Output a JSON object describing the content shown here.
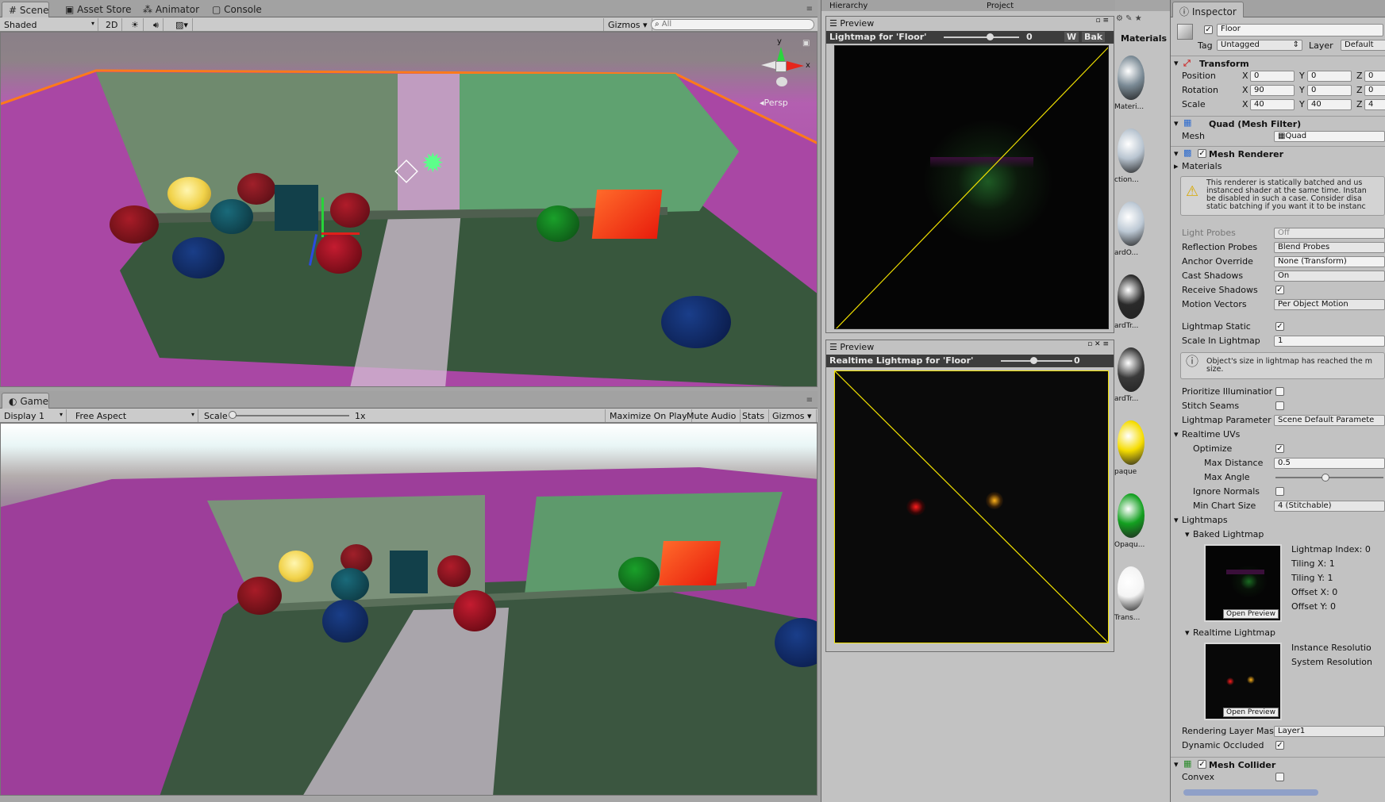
{
  "scene": {
    "tabs": [
      {
        "label": "Scene"
      },
      {
        "label": "Asset Store"
      },
      {
        "label": "Animator"
      },
      {
        "label": "Console"
      }
    ],
    "shading_mode": "Shaded",
    "mode_2d": "2D",
    "gizmos": "Gizmos",
    "search_placeholder": "All",
    "persp_label": "Persp",
    "axis_y": "y",
    "axis_x": "x"
  },
  "game": {
    "tab": "Game",
    "display": "Display 1",
    "aspect": "Free Aspect",
    "scale_label": "Scale",
    "scale_value": "1x",
    "buttons": [
      "Maximize On Play",
      "Mute Audio",
      "Stats",
      "Gizmos"
    ]
  },
  "middle": {
    "hierarchy_tab": "Hierarchy",
    "project_tab": "Project",
    "materials_header": "Materials",
    "preview1": {
      "tab": "Preview",
      "title": "Lightmap for 'Floor'",
      "value": "0",
      "w_btn": "W",
      "bake_btn": "Bak"
    },
    "preview2": {
      "tab": "Preview",
      "title": "Realtime Lightmap for 'Floor'",
      "value": "0"
    },
    "materials": [
      {
        "label": "Materi...",
        "color": "#7a8a95"
      },
      {
        "label": "ction...",
        "color": "#b8c4d0"
      },
      {
        "label": "ardO...",
        "color": "#bcc8d4"
      },
      {
        "label": "ardTr...",
        "color": "#2a2a2a"
      },
      {
        "label": "ardTr...",
        "color": "#3a3a3a"
      },
      {
        "label": "paque",
        "color": "#f5dc00"
      },
      {
        "label": "Opaqu...",
        "color": "#13a020"
      },
      {
        "label": "Trans...",
        "color": "#f4f4f4"
      }
    ]
  },
  "inspector": {
    "tab": "Inspector",
    "object_name": "Floor",
    "tag_label": "Tag",
    "tag_value": "Untagged",
    "layer_label": "Layer",
    "layer_value": "Default",
    "transform": {
      "title": "Transform",
      "rows": [
        {
          "label": "Position",
          "x": "0",
          "y": "0",
          "z": "0"
        },
        {
          "label": "Rotation",
          "x": "90",
          "y": "0",
          "z": "0"
        },
        {
          "label": "Scale",
          "x": "40",
          "y": "40",
          "z": "4"
        }
      ]
    },
    "mesh_filter": {
      "title": "Quad (Mesh Filter)",
      "mesh_label": "Mesh",
      "mesh_value": "Quad"
    },
    "mesh_renderer": {
      "title": "Mesh Renderer",
      "materials_label": "Materials",
      "warning_lines": [
        "This renderer is statically batched and us",
        "instanced shader at the same time. Instan",
        "be disabled in such a case. Consider disa",
        "static batching if you want it to be instanc"
      ],
      "light_probes_label": "Light Probes",
      "light_probes_value": "Off",
      "reflection_probes_label": "Reflection Probes",
      "reflection_probes_value": "Blend Probes",
      "anchor_override_label": "Anchor Override",
      "anchor_override_value": "None (Transform)",
      "cast_shadows_label": "Cast Shadows",
      "cast_shadows_value": "On",
      "receive_shadows_label": "Receive Shadows",
      "motion_vectors_label": "Motion Vectors",
      "motion_vectors_value": "Per Object Motion",
      "lightmap_static_label": "Lightmap Static",
      "scale_in_lightmap_label": "Scale In Lightmap",
      "scale_in_lightmap_value": "1",
      "info_lines": [
        "Object's size in lightmap has reached the m",
        "size."
      ],
      "prioritize_label": "Prioritize Illuminatior",
      "stitch_label": "Stitch Seams",
      "lightmap_params_label": "Lightmap Parameter",
      "lightmap_params_value": "Scene Default Paramete",
      "realtime_uvs_label": "Realtime UVs",
      "optimize_label": "Optimize",
      "max_distance_label": "Max Distance",
      "max_distance_value": "0.5",
      "max_angle_label": "Max Angle",
      "ignore_normals_label": "Ignore Normals",
      "min_chart_label": "Min Chart Size",
      "min_chart_value": "4 (Stitchable)",
      "lightmaps_label": "Lightmaps",
      "baked_lightmap_label": "Baked Lightmap",
      "baked_info": [
        "Lightmap Index: 0",
        "Tiling X: 1",
        "Tiling Y: 1",
        "Offset X: 0",
        "Offset Y: 0"
      ],
      "open_preview": "Open Preview",
      "realtime_lightmap_label": "Realtime Lightmap",
      "realtime_info": [
        "Instance Resolutio",
        "System Resolution"
      ],
      "rendering_layer_label": "Rendering Layer Mas",
      "rendering_layer_value": "Layer1",
      "dynamic_occluded_label": "Dynamic Occluded"
    },
    "mesh_collider": {
      "title": "Mesh Collider",
      "convex_label": "Convex"
    }
  }
}
